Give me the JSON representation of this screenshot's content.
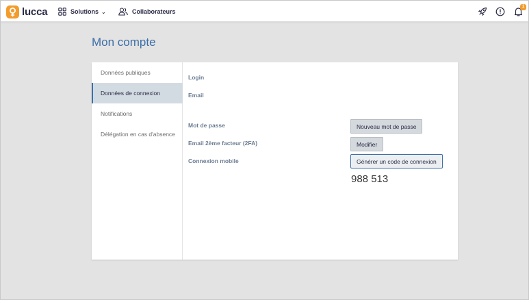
{
  "app": {
    "logo_text": "lucca",
    "brand_color": "#f39c2b",
    "accent_color": "#3d6fa8"
  },
  "topbar": {
    "nav": [
      {
        "label": "Solutions",
        "icon": "grid-icon",
        "has_dropdown": true
      },
      {
        "label": "Collaborateurs",
        "icon": "users-icon",
        "has_dropdown": false
      }
    ],
    "icons": [
      "rocket-icon",
      "info-icon",
      "bell-icon"
    ],
    "notifications_count": "1"
  },
  "page": {
    "title": "Mon compte"
  },
  "sidenav": {
    "items": [
      {
        "label": "Données publiques",
        "active": false
      },
      {
        "label": "Données de connexion",
        "active": true
      },
      {
        "label": "Notifications",
        "active": false
      },
      {
        "label": "Délégation en cas d'absence",
        "active": false
      }
    ]
  },
  "connexion": {
    "login_label": "Login",
    "email_label": "Email",
    "password_label": "Mot de passe",
    "password_button": "Nouveau mot de passe",
    "twofa_label": "Email 2ème facteur (2FA)",
    "twofa_button": "Modifier",
    "mobile_label": "Connexion mobile",
    "mobile_button": "Générer un code de connexion",
    "mobile_code": "988 513"
  }
}
